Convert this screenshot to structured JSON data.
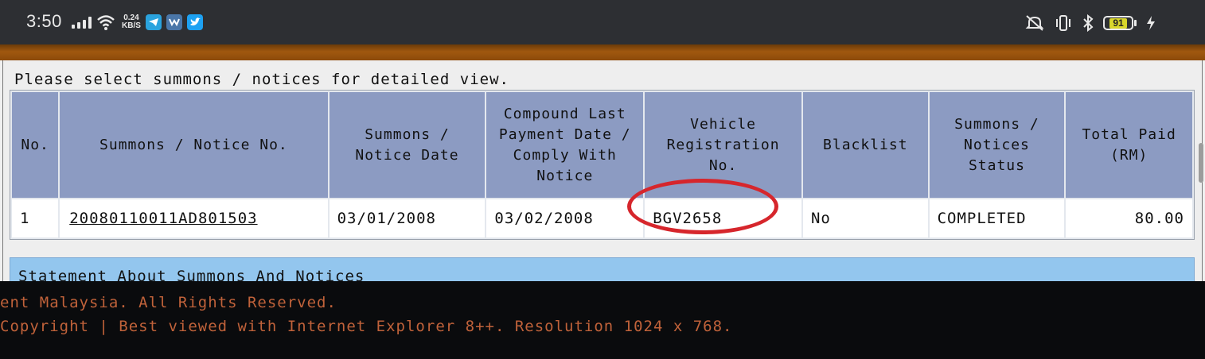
{
  "status_bar": {
    "time": "3:50",
    "net_speed_value": "0.24",
    "net_speed_unit": "KB/S",
    "battery_level": "91",
    "icons": [
      "signal-icon",
      "wifi-icon",
      "telegram-icon",
      "vk-icon",
      "twitter-icon",
      "mute-icon",
      "vibrate-icon",
      "bluetooth-icon",
      "battery-icon",
      "charging-icon"
    ]
  },
  "page": {
    "instruction": "Please select summons / notices for detailed view.",
    "table": {
      "headers": [
        "No.",
        "Summons / Notice No.",
        "Summons / Notice Date",
        "Compound Last Payment Date / Comply With Notice",
        "Vehicle Registration No.",
        "Blacklist",
        "Summons / Notices Status",
        "Total Paid (RM)"
      ],
      "rows": [
        {
          "no": "1",
          "notice_no": "20080110011AD801503",
          "notice_date": "03/01/2008",
          "last_payment_date": "03/02/2008",
          "vehicle_reg": "BGV2658",
          "blacklist": "No",
          "status": "COMPLETED",
          "total_paid": "80.00"
        }
      ]
    },
    "statement_heading": "Statement About Summons And Notices"
  },
  "footer": {
    "line1": "ent Malaysia. All Rights Reserved.",
    "line2": "Copyright | Best viewed with Internet Explorer 8++. Resolution 1024 x 768."
  },
  "colors": {
    "header_bg": "#8c9bc2",
    "statement_bg": "#93c6ee",
    "footer_text": "#c0623a",
    "annotation_circle": "#d6262c"
  }
}
